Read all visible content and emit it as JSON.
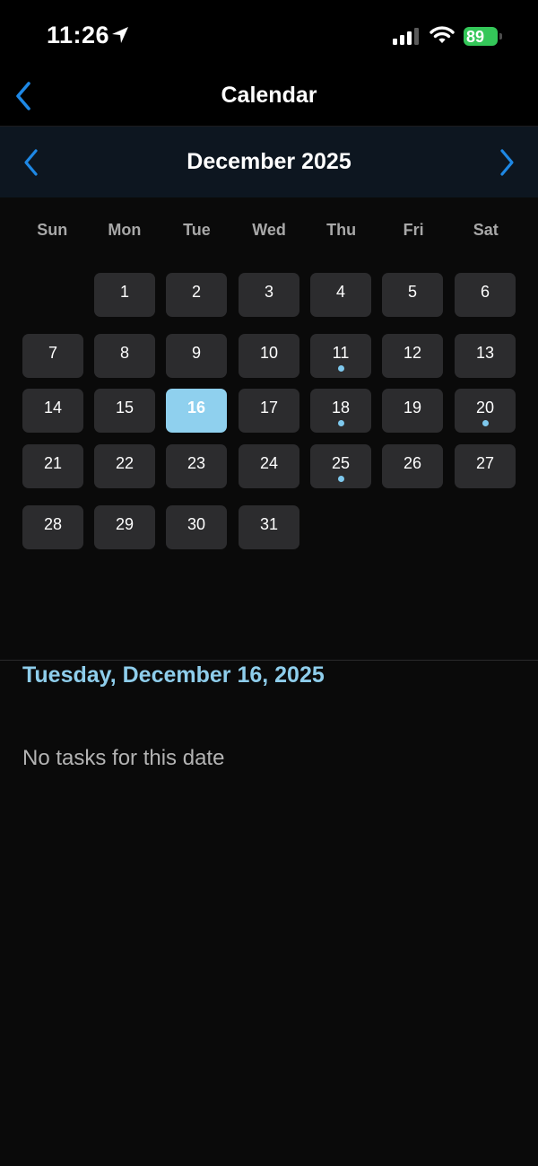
{
  "status_bar": {
    "time": "11:26",
    "battery": "89"
  },
  "nav": {
    "title": "Calendar"
  },
  "calendar": {
    "month_title": "December 2025",
    "weekdays": [
      "Sun",
      "Mon",
      "Tue",
      "Wed",
      "Thu",
      "Fri",
      "Sat"
    ],
    "first_weekday_index": 1,
    "days_in_month": 31,
    "selected_day": 16,
    "days_with_tasks": [
      11,
      18,
      20,
      25
    ],
    "accent_color": "#8fd0ee",
    "dot_color": "#7ec8ed"
  },
  "details": {
    "selected_date_label": "Tuesday, December 16, 2025",
    "empty_message": "No tasks for this date"
  }
}
